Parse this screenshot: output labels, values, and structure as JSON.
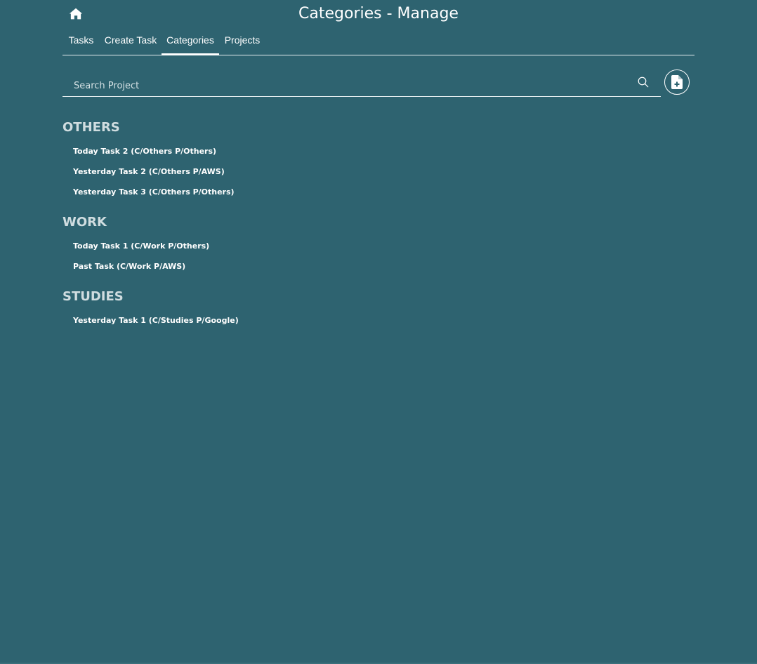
{
  "header": {
    "title": "Categories - Manage",
    "home_icon": "home-icon"
  },
  "tabs": [
    {
      "label": "Tasks",
      "active": false
    },
    {
      "label": "Create Task",
      "active": false
    },
    {
      "label": "Categories",
      "active": true
    },
    {
      "label": "Projects",
      "active": false
    }
  ],
  "search": {
    "value": "",
    "placeholder": "Search Project",
    "icon": "search-icon"
  },
  "add_button": {
    "icon": "file-add-icon"
  },
  "groups": [
    {
      "title": "OTHERS",
      "items": [
        "Today Task 2 (C/Others P/Others)",
        "Yesterday Task 2 (C/Others P/AWS)",
        "Yesterday Task 3 (C/Others P/Others)"
      ]
    },
    {
      "title": "WORK",
      "items": [
        "Today Task 1 (C/Work P/Others)",
        "Past Task (C/Work P/AWS)"
      ]
    },
    {
      "title": "STUDIES",
      "items": [
        "Yesterday Task 1 (C/Studies P/Google)"
      ]
    }
  ],
  "colors": {
    "background": "#2e6370",
    "text": "#ffffff",
    "group_title": "#d0dde0"
  }
}
